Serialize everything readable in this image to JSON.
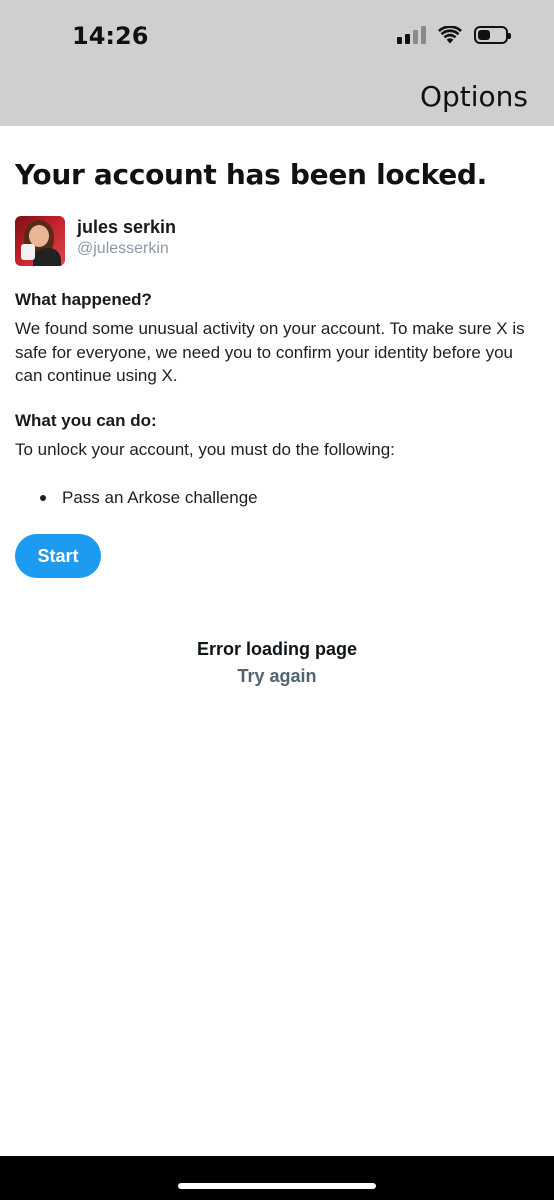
{
  "status_bar": {
    "time": "14:26",
    "icons": [
      "cellular-signal-icon",
      "wifi-icon",
      "battery-icon"
    ],
    "battery_level_percent": 45
  },
  "header": {
    "options_label": "Options"
  },
  "page": {
    "title": "Your account has been locked."
  },
  "account": {
    "name": "jules serkin",
    "handle": "@julesserkin"
  },
  "what_happened": {
    "heading": "What happened?",
    "body": "We found some unusual activity on your account. To make sure X is safe for everyone, we need you to confirm your identity before you can continue using X."
  },
  "what_you_can_do": {
    "heading": "What you can do:",
    "body": "To unlock your account, you must do the following:",
    "steps": [
      "Pass an Arkose challenge"
    ]
  },
  "actions": {
    "start_label": "Start"
  },
  "error": {
    "message": "Error loading page",
    "retry_label": "Try again"
  },
  "colors": {
    "accent": "#1d9bf0",
    "header_bg": "#cfcfcf",
    "secondary_text": "#536471",
    "handle_text": "#8899a6"
  }
}
